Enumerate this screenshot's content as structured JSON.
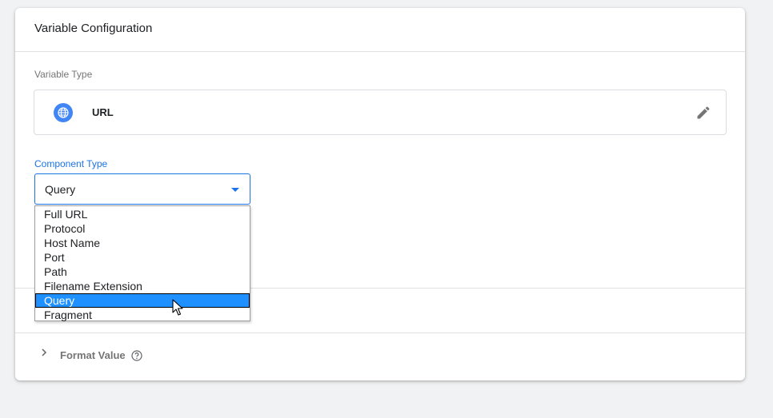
{
  "card": {
    "title": "Variable Configuration"
  },
  "variable_type": {
    "label": "Variable Type",
    "name": "URL",
    "icon": "globe-icon",
    "edit_icon": "pencil-icon"
  },
  "component_type": {
    "label": "Component Type",
    "selected": "Query",
    "options": [
      "Full URL",
      "Protocol",
      "Host Name",
      "Port",
      "Path",
      "Filename Extension",
      "Query",
      "Fragment"
    ],
    "highlighted_index": 6
  },
  "format_value": {
    "label": "Format Value",
    "icon": "help-icon"
  },
  "colors": {
    "accent": "#1a73e8",
    "icon_circle": "#4285f4",
    "highlight": "#1e90ff"
  }
}
